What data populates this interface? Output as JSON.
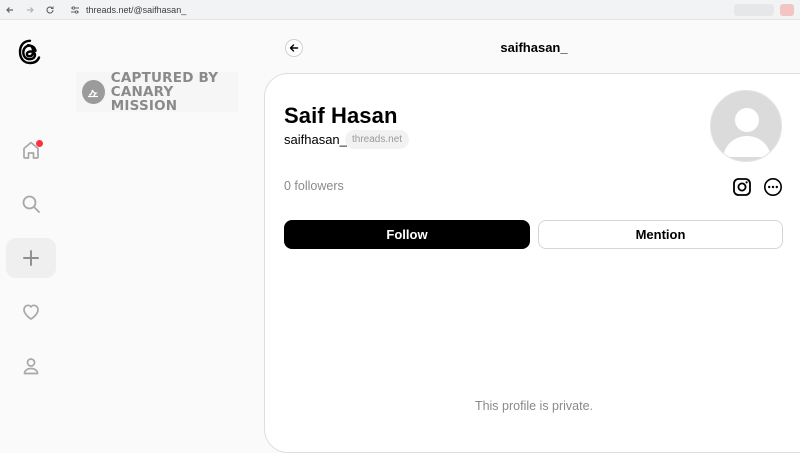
{
  "browser": {
    "url": "threads.net/@saifhasan_"
  },
  "watermark": {
    "line1": "CAPTURED BY",
    "line2": "CANARY MISSION"
  },
  "header": {
    "title": "saifhasan_"
  },
  "profile": {
    "name": "Saif Hasan",
    "handle": "saifhasan_",
    "domain_badge": "threads.net",
    "followers": "0 followers",
    "follow_label": "Follow",
    "mention_label": "Mention",
    "private_note": "This profile is private."
  },
  "nav": {
    "icons": [
      "threads-logo-icon",
      "home-icon",
      "search-icon",
      "create-icon",
      "heart-icon",
      "profile-icon"
    ]
  },
  "colors": {
    "notification_dot": "#ff3040",
    "primary_button": "#000000",
    "muted_text": "#8a8a8a"
  }
}
